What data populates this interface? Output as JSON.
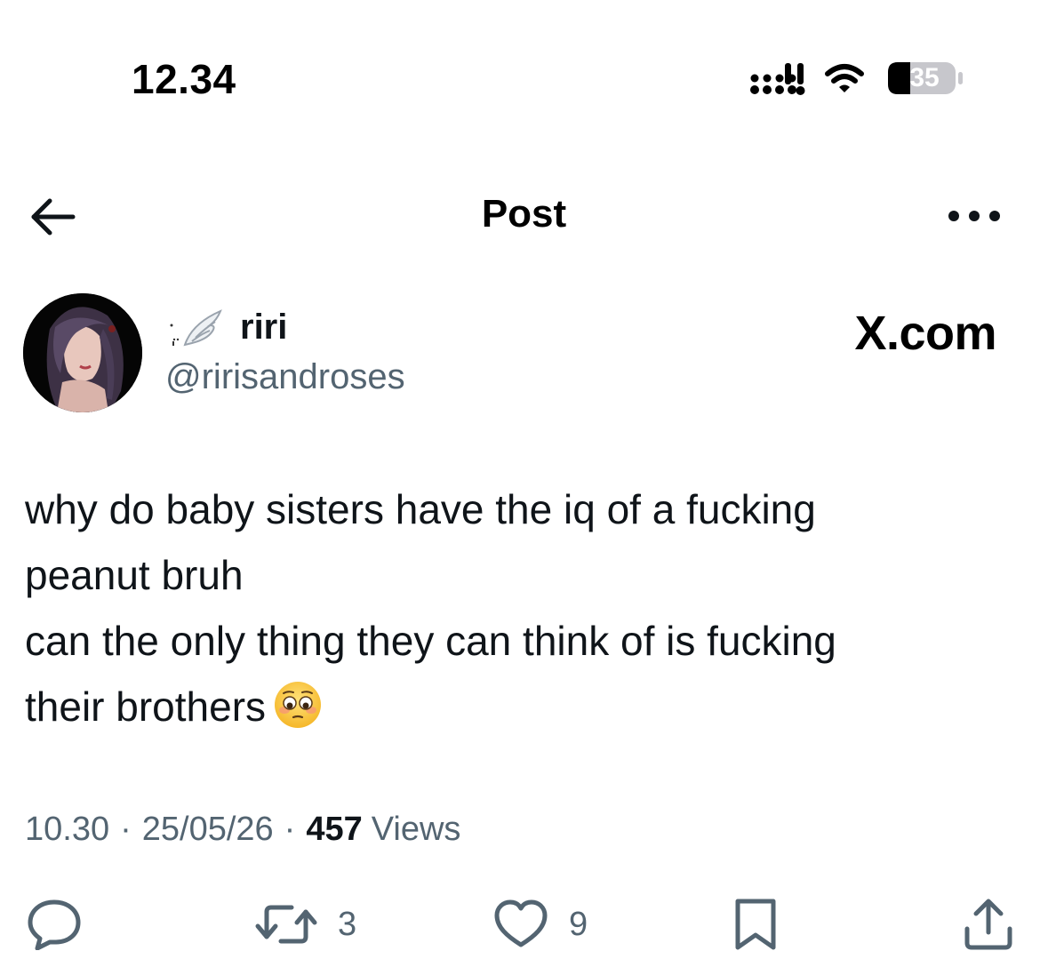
{
  "status_bar": {
    "time": "12.34",
    "battery_level": "35"
  },
  "header": {
    "title": "Post",
    "back_icon": "arrow-left-icon",
    "more_icon": "more-horizontal-icon"
  },
  "author": {
    "display_name": "riri",
    "handle": "@ririsandroses",
    "name_decoration_icon": "angel-wing-icon"
  },
  "watermark": "X.com",
  "tweet": {
    "lines": [
      "why do baby sisters have the iq of a fucking",
      "peanut bruh",
      "can the only thing they can think of is fucking",
      "their brothers"
    ],
    "emoji": "pleading-face-emoji"
  },
  "meta": {
    "time": "10.30",
    "date": "25/05/26",
    "views_count": "457",
    "views_label": "Views",
    "separator": "·"
  },
  "actions": {
    "reply_icon": "reply-icon",
    "retweet_icon": "retweet-icon",
    "retweet_count": "3",
    "like_icon": "heart-icon",
    "like_count": "9",
    "bookmark_icon": "bookmark-icon",
    "share_icon": "share-icon"
  },
  "colors": {
    "text_primary": "#0f1419",
    "text_secondary": "#536471",
    "icon": "#536471",
    "background": "#ffffff"
  }
}
